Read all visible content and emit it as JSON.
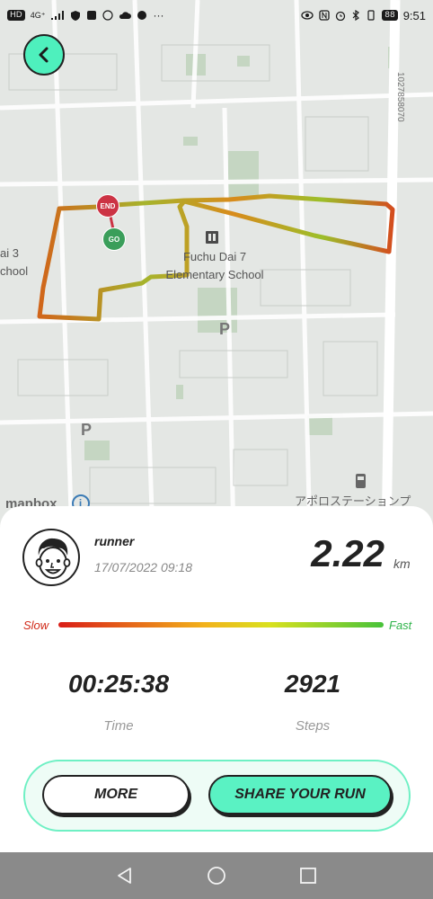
{
  "status_bar": {
    "left_badge": "HD",
    "network": "4G⁺",
    "icons": [
      "signal-icon",
      "wifi-icon",
      "shield-icon",
      "app-icon",
      "app-icon",
      "cloud-icon",
      "chat-icon",
      "more-icon"
    ],
    "right_icons": [
      "eye-icon",
      "nfc-icon",
      "alarm-icon",
      "bluetooth-icon",
      "vibrate-icon"
    ],
    "battery": "88",
    "time": "9:51"
  },
  "map": {
    "labels": {
      "school_name_1": "Fuchu Dai 7",
      "school_name_2": "Elementary School",
      "left_label_1": "ai 3",
      "left_label_2": "chool",
      "parking_1": "P",
      "parking_2": "P",
      "station": "アポロステーションプ",
      "attribution": "mapbox",
      "coordinates": "1027858070"
    },
    "markers": {
      "end": "END",
      "go": "GO"
    }
  },
  "run": {
    "runner_name": "runner",
    "date": "17/07/2022 09:18",
    "distance": "2.22",
    "distance_unit": "km",
    "speed_scale": {
      "slow": "Slow",
      "fast": "Fast"
    },
    "time_value": "00:25:38",
    "time_label": "Time",
    "steps_value": "2921",
    "steps_label": "Steps"
  },
  "buttons": {
    "more": "MORE",
    "share": "SHARE YOUR RUN"
  },
  "colors": {
    "accent": "#4ef0bd",
    "slow": "#d12b1a",
    "fast": "#2fb34a",
    "end_marker": "#cc3344",
    "go_marker": "#3a9e5a"
  }
}
